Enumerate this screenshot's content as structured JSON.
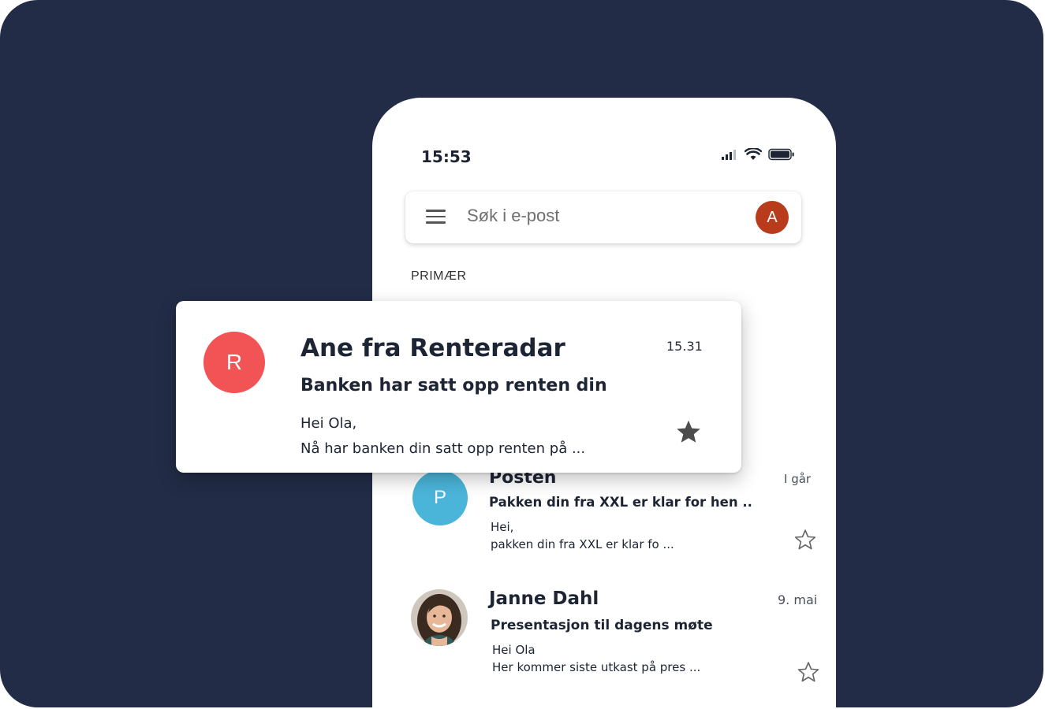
{
  "status_bar": {
    "time": "15:53"
  },
  "search": {
    "placeholder": "Søk i e-post",
    "account_initial": "A",
    "account_color": "#b83b1c"
  },
  "inbox": {
    "section_label": "PRIMÆR",
    "emails": [
      {
        "sender": "Posten",
        "date": "I går",
        "subject": "Pakken din fra XXL er klar for hen ..",
        "preview_line1": "Hei,",
        "preview_line2": "pakken din fra XXL er klar fo ...",
        "avatar_initial": "P",
        "avatar_color": "#4bb5d9",
        "starred": false
      },
      {
        "sender": "Janne Dahl",
        "date": "9. mai",
        "subject": "Presentasjon til dagens møte",
        "preview_line1": "Hei Ola",
        "preview_line2": "Her kommer siste utkast på pres ...",
        "avatar": "photo",
        "starred": false
      }
    ]
  },
  "highlight": {
    "sender": "Ane fra Renteradar",
    "time": "15.31",
    "subject": "Banken har satt opp renten din",
    "preview_line1": "Hei Ola,",
    "preview_line2": "Nå har banken din satt opp renten på ...",
    "avatar_initial": "R",
    "avatar_color": "#f25354",
    "starred": true
  },
  "colors": {
    "background": "#222c47",
    "text": "#1d2433"
  }
}
